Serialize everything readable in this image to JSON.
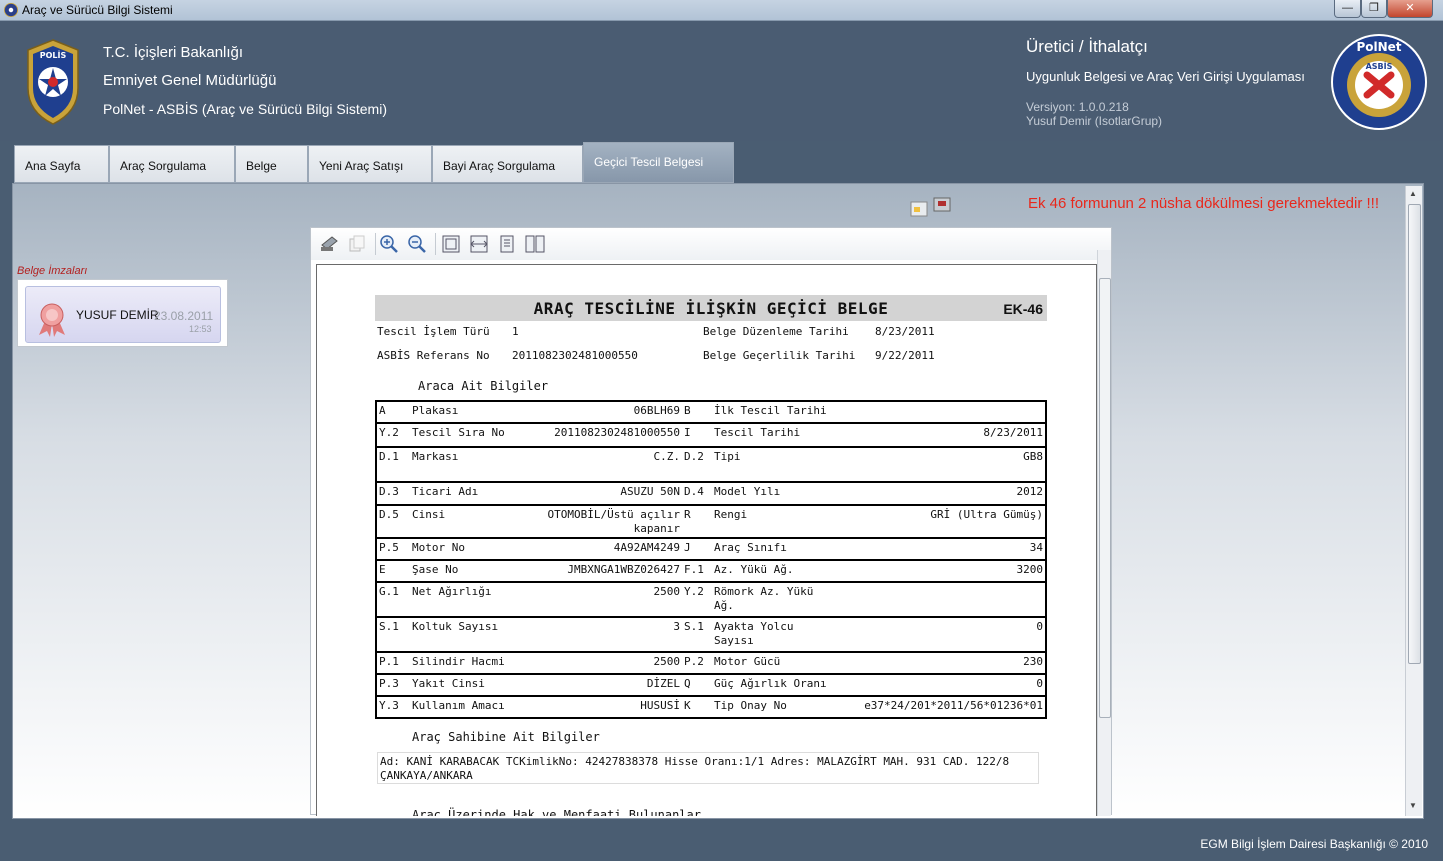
{
  "window": {
    "title": "Araç ve Sürücü Bilgi Sistemi",
    "min_icon": "minimize-icon",
    "max_icon": "maximize-icon",
    "close_icon": "close-icon",
    "min_glyph": "—",
    "max_glyph": "❐",
    "close_glyph": "✕"
  },
  "header": {
    "line1": "T.C. İçişleri Bakanlığı",
    "line2": "Emniyet Genel Müdürlüğü",
    "line3": "PolNet - ASBİS (Araç ve Sürücü Bilgi Sistemi)",
    "right_title": "Üretici / İthalatçı",
    "right_subtitle": "Uygunluk Belgesi ve Araç Veri Girişi Uygulaması",
    "version": "Versiyon:  1.0.0.218",
    "user": "Yusuf Demir (IsotlarGrup)",
    "polnet_text": "PolNet",
    "polnet_sub": "ASBİS"
  },
  "tabs": [
    {
      "label": "Ana Sayfa"
    },
    {
      "label": "Araç Sorgulama"
    },
    {
      "label": "Belge"
    },
    {
      "label": "Yeni Araç Satışı"
    },
    {
      "label": "Bayi Araç Sorgulama"
    },
    {
      "label": "Geçici Tescil Belgesi"
    }
  ],
  "warning": "Ek 46 formunun 2 nüsha dökülmesi gerekmektedir !!!",
  "signatures": {
    "label": "Belge İmzaları",
    "name": "YUSUF DEMİR",
    "date": "23.08.2011",
    "time": "12:53"
  },
  "document": {
    "title": "ARAÇ TESCİLİNE İLİŞKİN GEÇİCİ BELGE",
    "ek": "EK-46",
    "islem_label": "Tescil İşlem Türü",
    "islem_value": "1",
    "duzenleme_label": "Belge Düzenleme Tarihi",
    "duzenleme_value": "8/23/2011",
    "ref_label": "ASBİS Referans No",
    "ref_value": "2011082302481000550",
    "gecerlilik_label": "Belge Geçerlilik Tarihi",
    "gecerlilik_value": "9/22/2011",
    "vehicle_section": "Araca Ait Bilgiler",
    "owner_section": "Araç Sahibine Ait Bilgiler",
    "owner_text": "Ad: KANİ KARABACAK TCKimlikNo: 42427838378 Hisse Oranı:1/1 Adres: MALAZGİRT MAH. 931 CAD. 122/8 ÇANKAYA/ANKARA",
    "rights_section": "Araç Üzerinde Hak ve Menfaati Bulunanlar",
    "rows": [
      {
        "c1": "A",
        "l1": "Plakası",
        "v1": "06BLH69",
        "c2": "B",
        "l2": "İlk Tescil Tarihi",
        "v2": ""
      },
      {
        "c1": "Y.2",
        "l1": "Tescil Sıra No",
        "v1": "2011082302481000550",
        "c2": "I",
        "l2": "Tescil Tarihi",
        "v2": "8/23/2011"
      },
      {
        "c1": "D.1",
        "l1": "Markası",
        "v1": "C.Z.",
        "c2": "D.2",
        "l2": "Tipi",
        "v2": "GB8"
      },
      {
        "c1": "D.3",
        "l1": "Ticari Adı",
        "v1": "ASUZU 50N",
        "c2": "D.4",
        "l2": "Model Yılı",
        "v2": "2012"
      },
      {
        "c1": "D.5",
        "l1": "Cinsi",
        "v1": "OTOMOBİL/Üstü açılır kapanır",
        "c2": "R",
        "l2": "Rengi",
        "v2": "GRİ (Ultra Gümüş)"
      },
      {
        "c1": "P.5",
        "l1": "Motor No",
        "v1": "4A92AM4249",
        "c2": "J",
        "l2": "Araç Sınıfı",
        "v2": "34"
      },
      {
        "c1": "E",
        "l1": "Şase No",
        "v1": "JMBXNGA1WBZ026427",
        "c2": "F.1",
        "l2": "Az. Yükü Ağ.",
        "v2": "3200"
      },
      {
        "c1": "G.1",
        "l1": "Net Ağırlığı",
        "v1": "2500",
        "c2": "Y.2",
        "l2": "Römork Az. Yükü Ağ.",
        "v2": ""
      },
      {
        "c1": "S.1",
        "l1": "Koltuk Sayısı",
        "v1": "3",
        "c2": "S.1",
        "l2": "Ayakta Yolcu Sayısı",
        "v2": "0"
      },
      {
        "c1": "P.1",
        "l1": "Silindir Hacmi",
        "v1": "2500",
        "c2": "P.2",
        "l2": "Motor Gücü",
        "v2": "230"
      },
      {
        "c1": "P.3",
        "l1": "Yakıt Cinsi",
        "v1": "DİZEL",
        "c2": "Q",
        "l2": "Güç Ağırlık Oranı",
        "v2": "0"
      },
      {
        "c1": "Y.3",
        "l1": "Kullanım Amacı",
        "v1": "HUSUSİ",
        "c2": "K",
        "l2": "Tip Onay No",
        "v2": "e37*24/201*2011/56*01236*01"
      }
    ]
  },
  "footer": "EGM Bilgi İşlem Dairesi Başkanlığı © 2010",
  "colors": {
    "header_bg": "#4a5c72",
    "warning": "#e8281c",
    "active_tab": "#8797aa"
  }
}
